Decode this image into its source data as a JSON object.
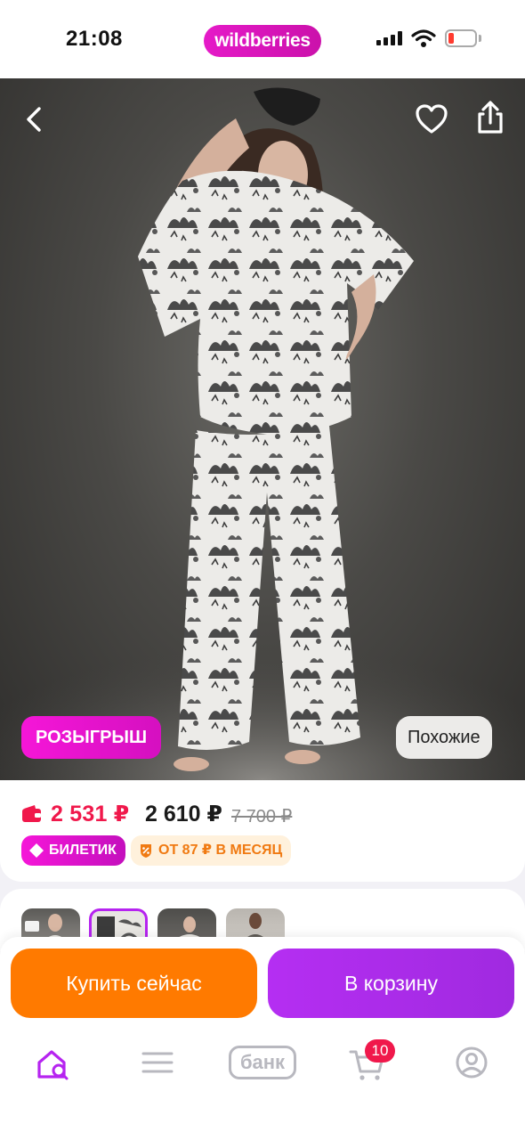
{
  "status_bar": {
    "time": "21:08",
    "brand": "wildberries"
  },
  "product": {
    "raffle_label": "РОЗЫГРЫШ",
    "similar_label": "Похожие"
  },
  "prices": {
    "wallet_price": "2 531 ₽",
    "price": "2 610 ₽",
    "old_price": "7 700 ₽",
    "ticket_label": "БИЛЕТИК",
    "installment_label": "ОТ 87 ₽ В МЕСЯЦ"
  },
  "actions": {
    "buy_now": "Купить сейчас",
    "add_to_cart": "В корзину"
  },
  "tabs": {
    "bank_label": "банк",
    "cart_count": "10"
  },
  "colors": {
    "brand": "#cb11ab",
    "buy_now": "#ff7a00",
    "add_to_cart": "#a72de6",
    "wallet_price": "#f0184b"
  }
}
